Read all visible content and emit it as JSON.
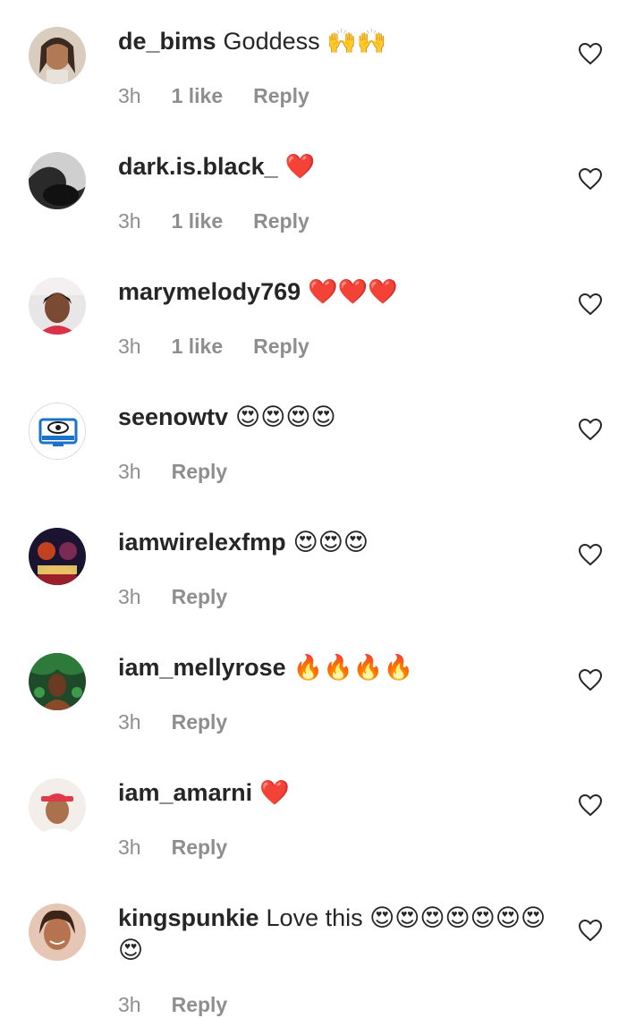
{
  "comments": [
    {
      "username": "de_bims",
      "text": "Goddess 🙌🙌",
      "time": "3h",
      "likes": "1 like",
      "reply": "Reply",
      "avatar": "avatar-woman-braids"
    },
    {
      "username": "dark.is.black_",
      "text": "❤️",
      "time": "3h",
      "likes": "1 like",
      "reply": "Reply",
      "avatar": "avatar-dark-silhouette"
    },
    {
      "username": "marymelody769",
      "text": "❤️❤️❤️",
      "time": "3h",
      "likes": "1 like",
      "reply": "Reply",
      "avatar": "avatar-woman-portrait"
    },
    {
      "username": "seenowtv",
      "text": "😍😍😍😍",
      "time": "3h",
      "likes": "",
      "reply": "Reply",
      "avatar": "avatar-seenowtv-logo"
    },
    {
      "username": "iamwirelexfmp",
      "text": "😍😍😍",
      "time": "3h",
      "likes": "",
      "reply": "Reply",
      "avatar": "avatar-yagazie-poster"
    },
    {
      "username": "iam_mellyrose",
      "text": "🔥🔥🔥🔥",
      "time": "3h",
      "likes": "",
      "reply": "Reply",
      "avatar": "avatar-green-scene"
    },
    {
      "username": "iam_amarni",
      "text": "❤️",
      "time": "3h",
      "likes": "",
      "reply": "Reply",
      "avatar": "avatar-man-red-cap"
    },
    {
      "username": "kingspunkie",
      "text": "Love this 😍😍😍😍😍😍😍😍",
      "time": "3h",
      "likes": "",
      "reply": "Reply",
      "avatar": "avatar-woman-smiling"
    }
  ],
  "icons": {
    "like": "heart-outline-icon"
  },
  "colors": {
    "text": "#262626",
    "meta": "#8e8e8e",
    "background": "#ffffff"
  }
}
